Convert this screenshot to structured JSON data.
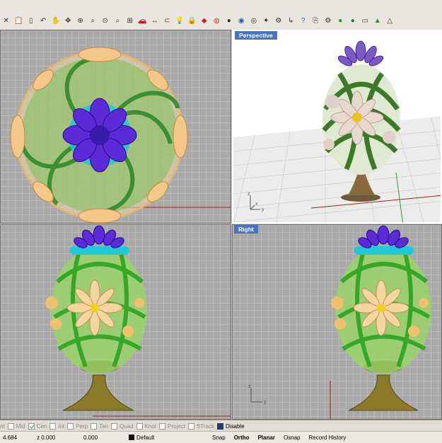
{
  "toolbar": {
    "icons": [
      "close-icon",
      "paste-icon",
      "clipboard-icon",
      "undo-icon",
      "pan-hand-icon",
      "move-icon",
      "zoom-extents-icon",
      "zoom-window-icon",
      "zoom-selected-icon",
      "zoom-dynamic-icon",
      "four-viewports-icon",
      "car-icon",
      "dimension-icon",
      "layer-icon",
      "lightbulb-icon",
      "lock-icon",
      "material-icon",
      "color-wheel-icon",
      "sphere-icon",
      "render-icon",
      "target-icon",
      "scroll-icon",
      "mesh-icon",
      "history-icon",
      "help-icon",
      "save-as-icon",
      "settings-icon",
      "green-sphere-icon",
      "color-sphere-icon",
      "window-icon",
      "tree-icon",
      "cone-icon"
    ]
  },
  "viewports": {
    "top": {
      "title": ""
    },
    "perspective": {
      "title": "Perspective"
    },
    "front": {
      "title": ""
    },
    "right": {
      "title": "Right"
    }
  },
  "axes": {
    "x": "x",
    "y": "y",
    "z": "z"
  },
  "osnaps": [
    {
      "label": "nt",
      "checked": false,
      "active": false
    },
    {
      "label": "Mid",
      "checked": false,
      "active": false
    },
    {
      "label": "Cen",
      "checked": true,
      "active": false
    },
    {
      "label": "Int",
      "checked": false,
      "active": false
    },
    {
      "label": "Perp",
      "checked": false,
      "active": false
    },
    {
      "label": "Tan",
      "checked": false,
      "active": false
    },
    {
      "label": "Quad",
      "checked": false,
      "active": false
    },
    {
      "label": "Knot",
      "checked": false,
      "active": false
    },
    {
      "label": "Project",
      "checked": false,
      "active": false
    },
    {
      "label": "STrack",
      "checked": false,
      "active": false
    },
    {
      "label": "Disable",
      "checked": true,
      "active": true
    }
  ],
  "status": {
    "x": "4.684",
    "z": "z 0.000",
    "w": "0.000",
    "layer": "Default",
    "snap": "Snap",
    "ortho": "Ortho",
    "planar": "Planar",
    "osnap": "Osnap",
    "record": "Record History"
  },
  "colors": {
    "viewport_title_bg": "#4a74c2",
    "viewport_bg": "#a9a9a9",
    "green": "#5dbb3a",
    "purple": "#5a2bd6",
    "cream": "#f2d9a6",
    "gold": "#9a7a3a"
  }
}
